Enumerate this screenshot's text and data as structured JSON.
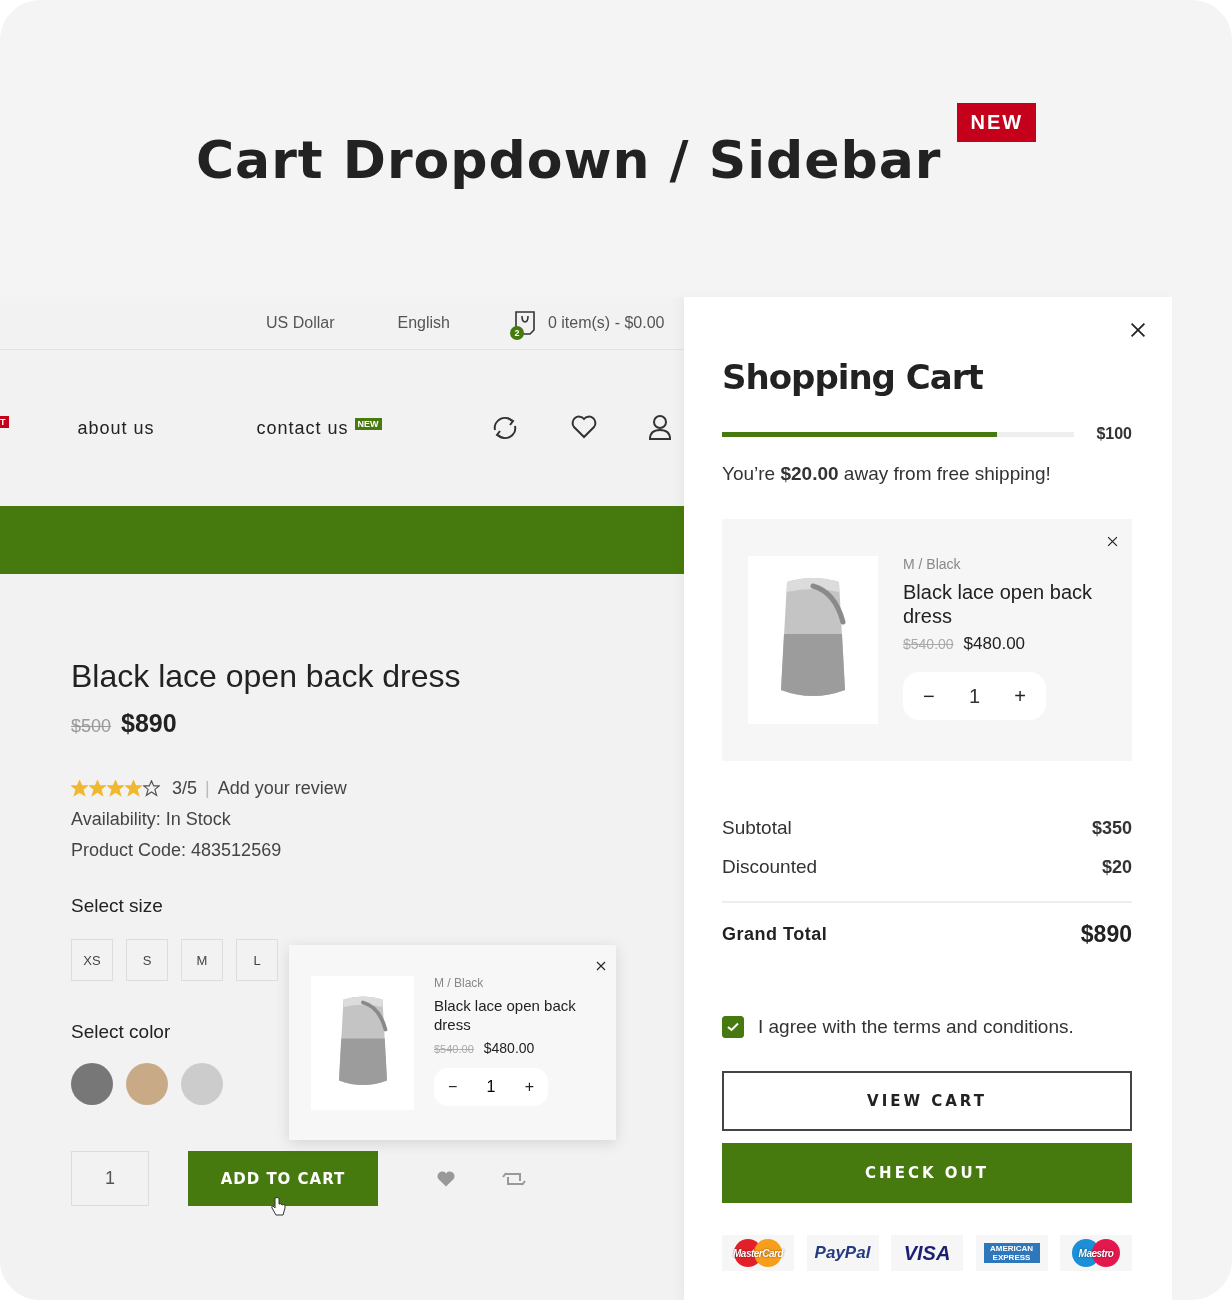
{
  "heading": {
    "title": "Cart Dropdown / Sidebar",
    "badge": "NEW"
  },
  "top_bar": {
    "currency": "US Dollar",
    "language": "English",
    "cart_count": "2",
    "cart_summary": "0 item(s) - $0.00"
  },
  "nav": {
    "cut_badge": "T",
    "items": [
      {
        "label": "about us"
      },
      {
        "label": "contact us",
        "badge": "NEW"
      }
    ]
  },
  "product": {
    "title": "Black lace open back dress",
    "old_price": "$500",
    "price": "$890",
    "stars": 4,
    "rating": "3/5",
    "separator": "|",
    "review_link": "Add your review",
    "availability": "Availability: In Stock",
    "code": "Product Code: 483512569",
    "size_label": "Select size",
    "sizes": [
      "XS",
      "S",
      "M",
      "L"
    ],
    "color_label": "Select color",
    "colors": [
      {
        "color": "#777777"
      },
      {
        "color": "#c9aa86"
      },
      {
        "color": "#cccccc"
      }
    ],
    "quantity": "1",
    "add_button": "ADD TO CART"
  },
  "mini_cart": {
    "variant": "M / Black",
    "name": "Black lace open back dress",
    "old_price": "$540.00",
    "price": "$480.00",
    "quantity": "1",
    "minus": "−",
    "plus": "+"
  },
  "cart": {
    "title": "Shopping Cart",
    "shipping_progress": {
      "level": 0.78
    },
    "threshold": "$100",
    "shipping_note": "You’re **$20.00** away from free shipping!",
    "item": {
      "variant": "M / Black",
      "name": "Black lace open back dress",
      "old_price": "$540.00",
      "price": "$480.00",
      "quantity": "1",
      "minus": "−",
      "plus": "+"
    },
    "subtotal_label": "Subtotal",
    "subtotal": "$350",
    "discount_label": "Discounted",
    "discount": "$20",
    "total_label": "Grand Total",
    "total": "$890",
    "agree": {
      "label": "I agree with the terms and conditions.",
      "checked": true
    },
    "view_button": "VIEW CART",
    "checkout_button": "CHECK OUT",
    "payments": [
      {
        "kind": "mastercard",
        "label": "MasterCard"
      },
      {
        "kind": "paypal",
        "label": "PayPal"
      },
      {
        "kind": "visa",
        "label": "VISA"
      },
      {
        "kind": "amex",
        "label": "AMERICAN EXPRESS"
      },
      {
        "kind": "maestro",
        "label": "Maestro"
      }
    ]
  }
}
